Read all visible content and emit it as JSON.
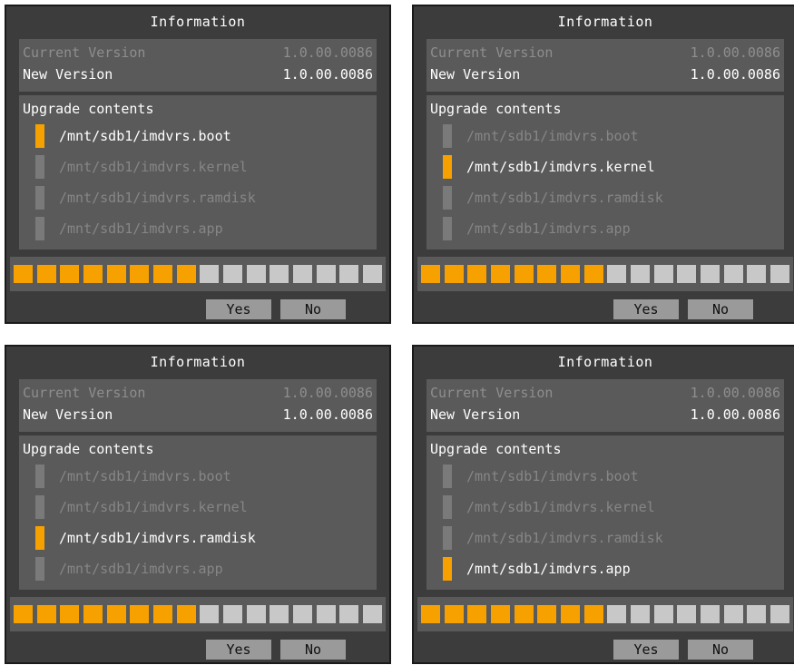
{
  "dialogs": [
    {
      "title": "Information",
      "current_version_label": "Current Version",
      "current_version_value": "1.0.00.0086",
      "new_version_label": "New Version",
      "new_version_value": "1.0.00.0086",
      "contents_heading": "Upgrade contents",
      "files": [
        "/mnt/sdb1/imdvrs.boot",
        "/mnt/sdb1/imdvrs.kernel",
        "/mnt/sdb1/imdvrs.ramdisk",
        "/mnt/sdb1/imdvrs.app"
      ],
      "active_file_index": 0,
      "progress": {
        "filled": 8,
        "total": 16
      },
      "yes_label": "Yes",
      "no_label": "No"
    },
    {
      "title": "Information",
      "current_version_label": "Current Version",
      "current_version_value": "1.0.00.0086",
      "new_version_label": "New Version",
      "new_version_value": "1.0.00.0086",
      "contents_heading": "Upgrade contents",
      "files": [
        "/mnt/sdb1/imdvrs.boot",
        "/mnt/sdb1/imdvrs.kernel",
        "/mnt/sdb1/imdvrs.ramdisk",
        "/mnt/sdb1/imdvrs.app"
      ],
      "active_file_index": 1,
      "progress": {
        "filled": 8,
        "total": 16
      },
      "yes_label": "Yes",
      "no_label": "No"
    },
    {
      "title": "Information",
      "current_version_label": "Current Version",
      "current_version_value": "1.0.00.0086",
      "new_version_label": "New Version",
      "new_version_value": "1.0.00.0086",
      "contents_heading": "Upgrade contents",
      "files": [
        "/mnt/sdb1/imdvrs.boot",
        "/mnt/sdb1/imdvrs.kernel",
        "/mnt/sdb1/imdvrs.ramdisk",
        "/mnt/sdb1/imdvrs.app"
      ],
      "active_file_index": 2,
      "progress": {
        "filled": 8,
        "total": 16
      },
      "yes_label": "Yes",
      "no_label": "No"
    },
    {
      "title": "Information",
      "current_version_label": "Current Version",
      "current_version_value": "1.0.00.0086",
      "new_version_label": "New Version",
      "new_version_value": "1.0.00.0086",
      "contents_heading": "Upgrade contents",
      "files": [
        "/mnt/sdb1/imdvrs.boot",
        "/mnt/sdb1/imdvrs.kernel",
        "/mnt/sdb1/imdvrs.ramdisk",
        "/mnt/sdb1/imdvrs.app"
      ],
      "active_file_index": 3,
      "progress": {
        "filled": 8,
        "total": 16
      },
      "yes_label": "Yes",
      "no_label": "No"
    }
  ],
  "colors": {
    "dialog_bg": "#3c3c3c",
    "panel_bg": "#5a5a5a",
    "accent_orange": "#f7a100",
    "segment_empty": "#c8c8c8",
    "inactive_text": "#868686",
    "button_bg": "#9a9a9a"
  }
}
